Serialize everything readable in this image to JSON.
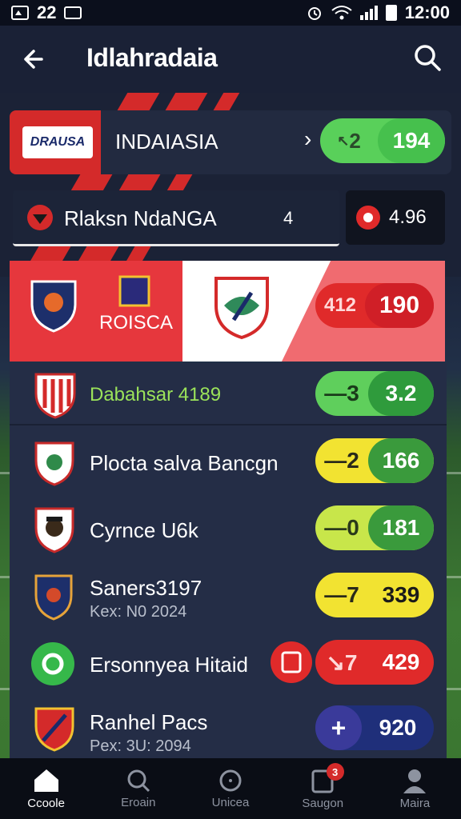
{
  "status_bar": {
    "left_text": "22",
    "time": "12:00"
  },
  "header": {
    "title": "Idlahradaia"
  },
  "featured": {
    "logo_text": "DRAUSA",
    "name": "INDAIASIA",
    "chevron": "›",
    "odds_left": "2",
    "odds_right": "194",
    "odds_left_prefix": "↖"
  },
  "subrow": {
    "name": "Rlaksn NdaNGA",
    "count": "4",
    "odds": "4.96"
  },
  "match_banner": {
    "team_text": "ROISCA",
    "odds_left": "412",
    "odds_right": "190"
  },
  "rows": [
    {
      "name": "Dabahsar 4189",
      "sub": "",
      "left": "—3",
      "right": "3.2",
      "colors": [
        "#5fcf5c",
        "#2f9b3c"
      ],
      "name_color": "#9be35a"
    },
    {
      "name": "Plocta salva Bancgn",
      "sub": "",
      "left": "—2",
      "right": "166",
      "colors": [
        "#f2e331",
        "#3a9a3c"
      ],
      "name_color": "#ffffff"
    },
    {
      "name": "Cyrnce U6k",
      "sub": "",
      "left": "—0",
      "right": "181",
      "colors": [
        "#c8e64a",
        "#3a9a3c"
      ],
      "name_color": "#ffffff"
    },
    {
      "name": "Saners3197",
      "sub": "Kex: N0 2024",
      "left": "—7",
      "right": "339",
      "colors": [
        "#f2e331",
        "#f2e331"
      ],
      "name_color": "#ffffff"
    },
    {
      "name": "Ersonnyea Hitaid",
      "sub": "",
      "left": "↘7",
      "right": "429",
      "colors": [
        "#e02a2a",
        "#e02a2a"
      ],
      "name_color": "#ffffff"
    },
    {
      "name": "Ranhel Pacs",
      "sub": "Pex: 3U: 2094",
      "left": "+",
      "right": "920",
      "colors": [
        "#2a3a8a",
        "#1f2f7a"
      ],
      "name_color": "#ffffff"
    }
  ],
  "nav": [
    {
      "label": "Ccoole",
      "icon": "home-icon"
    },
    {
      "label": "Eroain",
      "icon": "search-icon"
    },
    {
      "label": "Unicea",
      "icon": "clock-icon"
    },
    {
      "label": "Saugon",
      "icon": "clipboard-icon",
      "badge": "3"
    },
    {
      "label": "Maira",
      "icon": "profile-icon"
    }
  ]
}
